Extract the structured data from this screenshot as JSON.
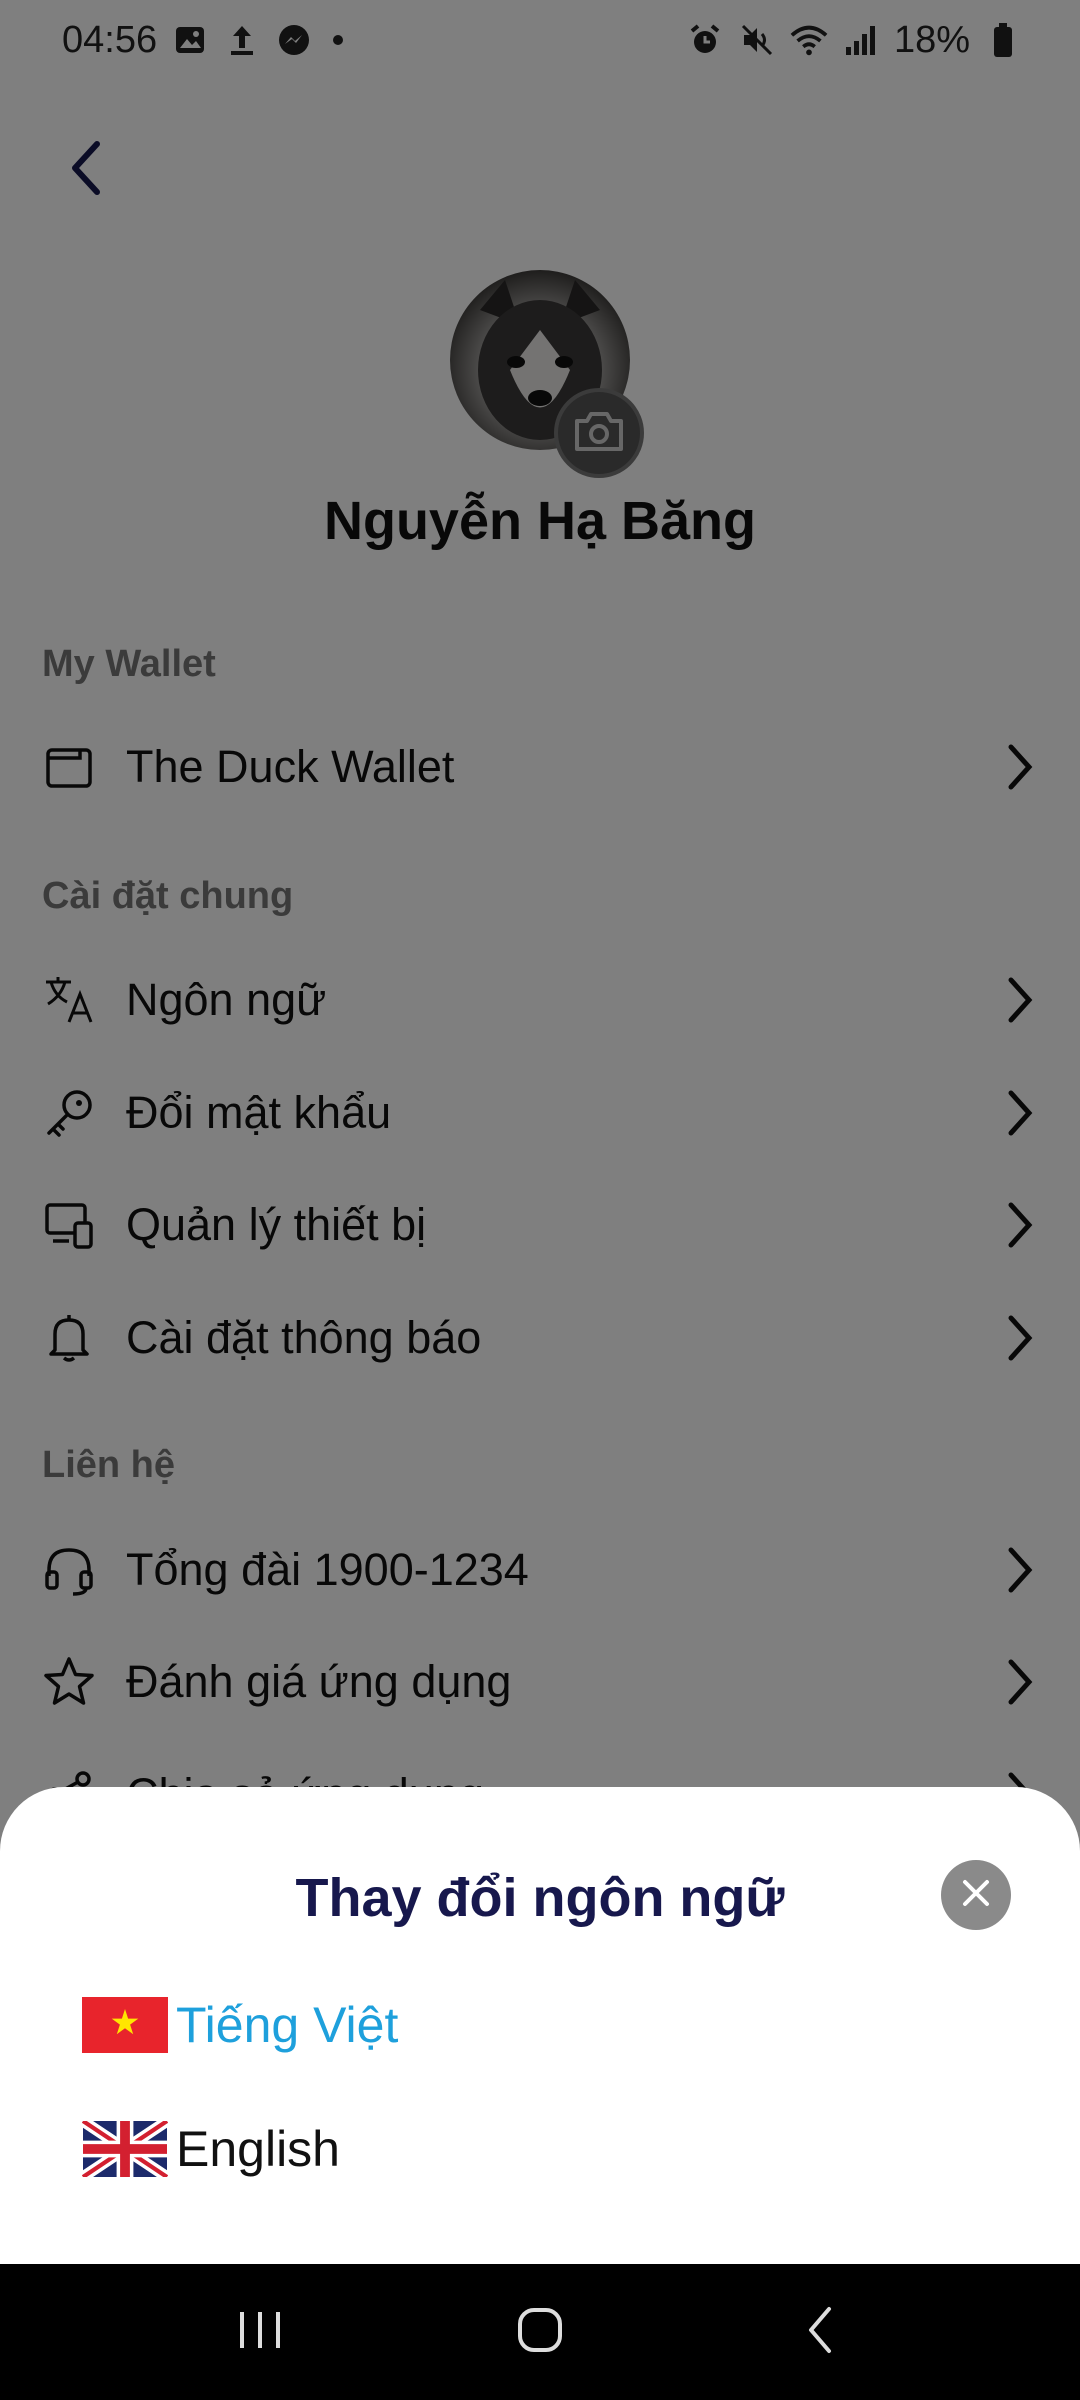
{
  "status_bar": {
    "time": "04:56",
    "battery": "18%"
  },
  "profile": {
    "name": "Nguyễn Hạ Băng"
  },
  "sections": {
    "wallet_title": "My Wallet",
    "general_title": "Cài đặt chung",
    "contact_title": "Liên hệ"
  },
  "menu": {
    "wallet": "The Duck Wallet",
    "language": "Ngôn ngữ",
    "password": "Đổi mật khẩu",
    "devices": "Quản lý thiết bị",
    "notifications": "Cài đặt thông báo",
    "hotline": "Tổng đài 1900-1234",
    "rate": "Đánh giá ứng dụng",
    "share": "Chia sẻ ứng dụng"
  },
  "language_sheet": {
    "title": "Thay đổi ngôn ngữ",
    "options": [
      {
        "label": "Tiếng Việt",
        "selected": true
      },
      {
        "label": "English",
        "selected": false
      }
    ],
    "active_color": "#1ea0dc",
    "title_color": "#17184d"
  },
  "icons": {
    "back": "chevron-left-icon",
    "camera": "camera-icon",
    "wallet": "wallet-icon",
    "language": "translate-icon",
    "password": "key-icon",
    "devices": "devices-icon",
    "notifications": "bell-icon",
    "hotline": "headset-icon",
    "rate": "star-icon",
    "share": "share-icon",
    "close": "close-icon"
  }
}
